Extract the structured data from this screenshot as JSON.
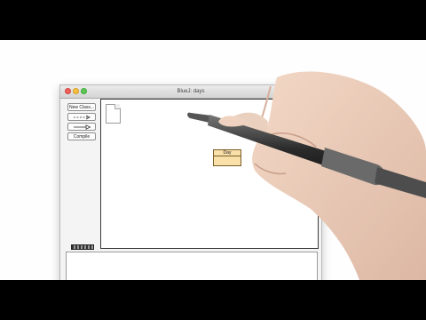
{
  "window": {
    "title": "BlueJ:  days"
  },
  "toolbar": {
    "new_class_label": "New Class...",
    "compile_label": "Compile",
    "arrows": [
      "dependency-arrow-icon",
      "inheritance-arrow-icon"
    ]
  },
  "canvas": {
    "class_box_label": "Day",
    "class_box_color": "#f9dfa8"
  },
  "status": {
    "progress_indicator": "striped-busy-icon"
  }
}
